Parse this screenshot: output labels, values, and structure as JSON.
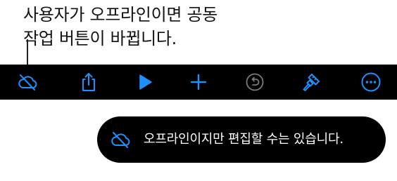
{
  "callout": {
    "line1": "사용자가 오프라인이면 공동",
    "line2": "작업 버튼이 바뀝니다."
  },
  "toolbar": {
    "accent_color": "#1E90FF",
    "disabled_color": "#7a7a7a",
    "items": [
      {
        "icon": "cloud-offline-icon"
      },
      {
        "icon": "share-icon"
      },
      {
        "icon": "play-icon"
      },
      {
        "icon": "add-icon"
      },
      {
        "icon": "undo-icon"
      },
      {
        "icon": "format-paintbrush-icon"
      },
      {
        "icon": "more-icon"
      }
    ]
  },
  "toast": {
    "icon": "cloud-offline-icon",
    "message": "오프라인이지만 편집할 수는 있습니다."
  }
}
